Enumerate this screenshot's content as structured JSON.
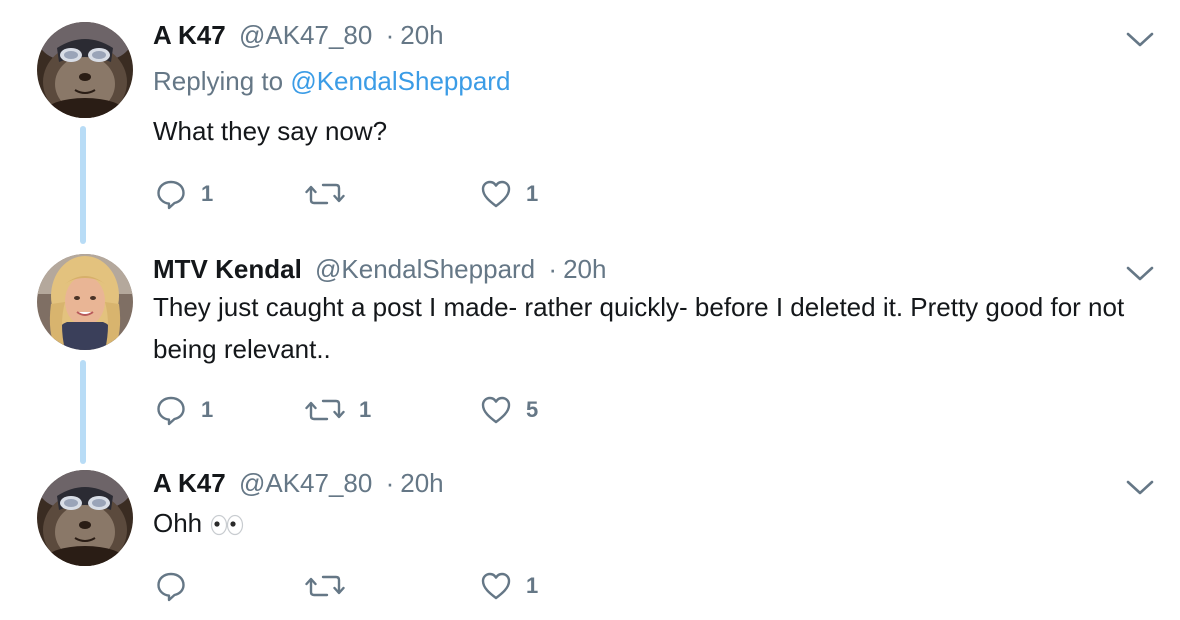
{
  "tweets": [
    {
      "name": "A K47",
      "handle": "@AK47_80",
      "separator": "·",
      "time": "20h",
      "replying_prefix": "Replying to ",
      "replying_handle": "@KendalSheppard",
      "text": "What they say now?",
      "replies": "1",
      "retweets": "",
      "likes": "1"
    },
    {
      "name": "MTV Kendal",
      "handle": "@KendalSheppard",
      "separator": "·",
      "time": "20h",
      "text": "They just caught a post I made- rather quickly- before I deleted it. Pretty good for not being relevant..",
      "replies": "1",
      "retweets": "1",
      "likes": "5"
    },
    {
      "name": "A K47",
      "handle": "@AK47_80",
      "separator": "·",
      "time": "20h",
      "text": "Ohh",
      "replies": "",
      "retweets": "",
      "likes": "1"
    }
  ],
  "icons": {
    "reply": "reply-icon",
    "retweet": "retweet-icon",
    "like": "like-icon",
    "more": "chevron-down-icon",
    "emoji": "eyes-emoji"
  },
  "colors": {
    "link": "#3b9ce6",
    "muted": "#657786",
    "thread_line": "#b8dcf6",
    "text": "#14171a"
  }
}
